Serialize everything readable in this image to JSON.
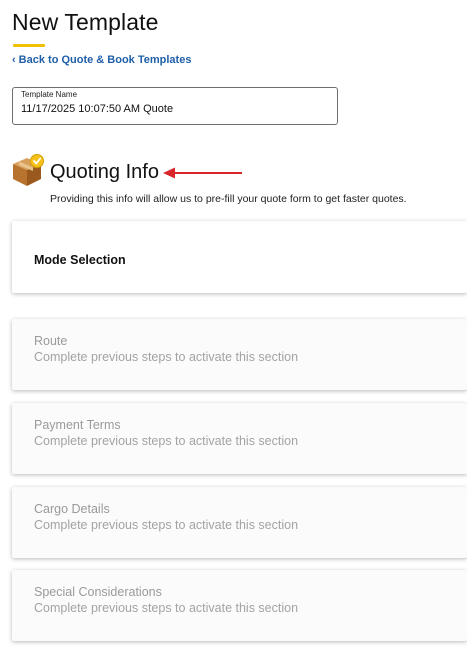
{
  "page": {
    "title": "New Template",
    "back_link": "Back to Quote & Book Templates"
  },
  "template_name": {
    "label": "Template Name",
    "value": "11/17/2025 10:07:50 AM Quote"
  },
  "quoting_info": {
    "title": "Quoting Info",
    "description": "Providing this info will allow us to pre-fill your quote form to get faster quotes.",
    "icon": "package-box-icon"
  },
  "sections": [
    {
      "title": "Mode Selection",
      "state": "active"
    },
    {
      "title": "Route",
      "subtitle": "Complete previous steps to activate this section",
      "state": "disabled"
    },
    {
      "title": "Payment Terms",
      "subtitle": "Complete previous steps to activate this section",
      "state": "disabled"
    },
    {
      "title": "Cargo Details",
      "subtitle": "Complete previous steps to activate this section",
      "state": "disabled"
    },
    {
      "title": "Special Considerations",
      "subtitle": "Complete previous steps to activate this section",
      "state": "disabled"
    }
  ],
  "colors": {
    "accent_underline": "#f2c200",
    "link": "#1f5fa8",
    "arrow": "#d9262b",
    "disabled_text": "#9a9a9a"
  }
}
